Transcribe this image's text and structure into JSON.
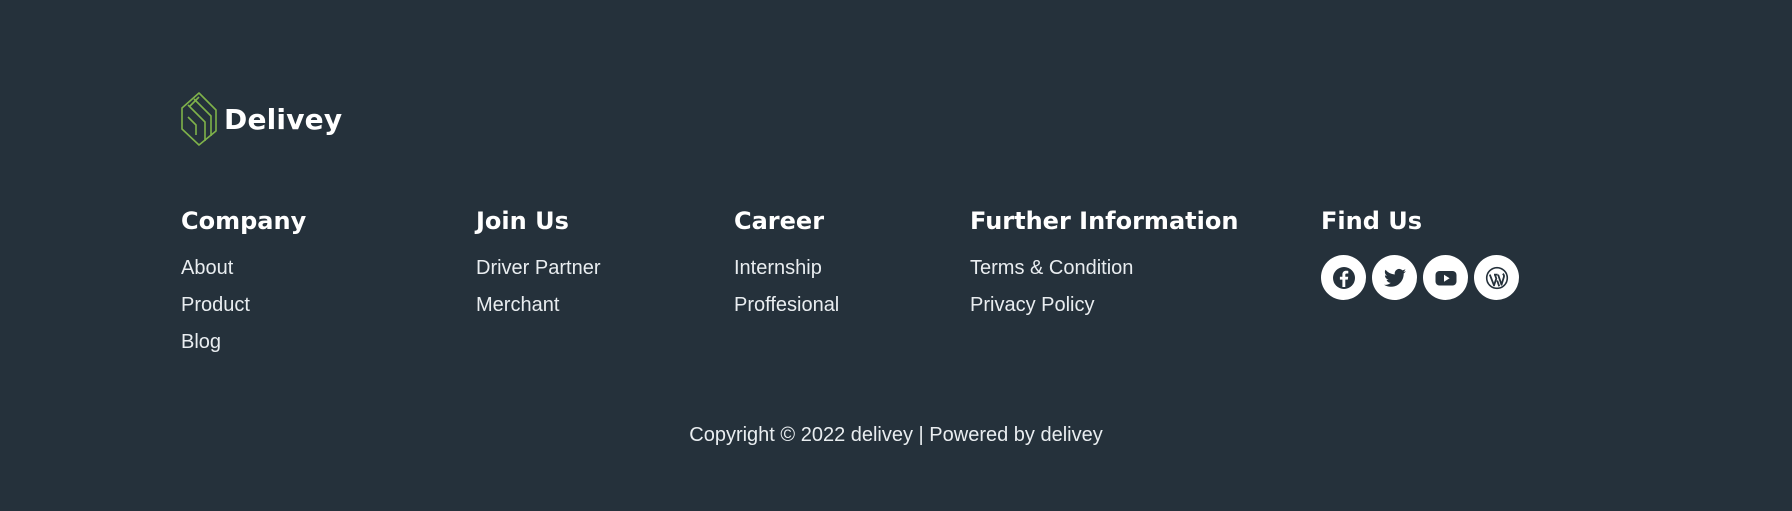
{
  "brand": {
    "name": "Delivey",
    "accent": "#7fb24a",
    "background": "#25313b"
  },
  "columns": [
    {
      "heading": "Company",
      "links": [
        "About",
        "Product",
        "Blog"
      ]
    },
    {
      "heading": "Join Us",
      "links": [
        "Driver Partner",
        "Merchant"
      ]
    },
    {
      "heading": "Career",
      "links": [
        "Internship",
        "Proffesional"
      ]
    },
    {
      "heading": "Further Information",
      "links": [
        "Terms & Condition",
        "Privacy Policy"
      ]
    }
  ],
  "find_us": {
    "heading": "Find Us",
    "icons": [
      "facebook-icon",
      "twitter-icon",
      "youtube-icon",
      "wordpress-icon"
    ]
  },
  "footer": {
    "copyright": "Copyright © 2022 delivey | Powered by delivey"
  }
}
